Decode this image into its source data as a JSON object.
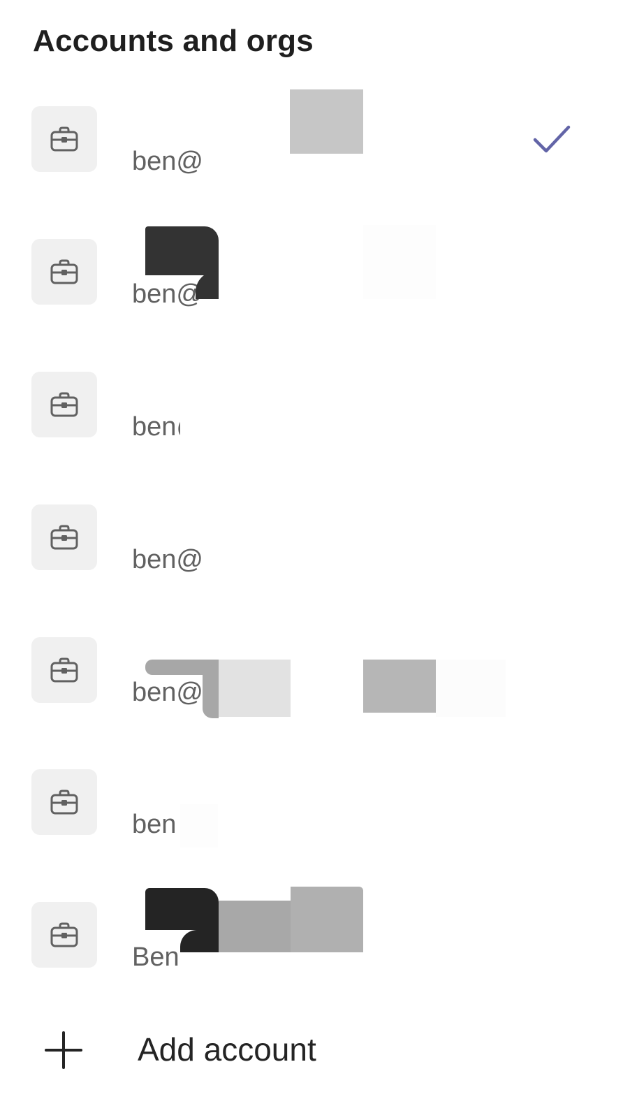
{
  "header": {
    "title": "Accounts and orgs"
  },
  "accounts": [
    {
      "email": "ben@",
      "selected": true
    },
    {
      "email": "ben@",
      "selected": false
    },
    {
      "email": "ben@",
      "selected": false
    },
    {
      "email": "ben@",
      "selected": false
    },
    {
      "email": "ben@",
      "selected": false
    },
    {
      "email": "ben",
      "selected": false
    },
    {
      "email": "Ben",
      "selected": false
    }
  ],
  "add_account": {
    "label": "Add account"
  },
  "icons": {
    "org": "briefcase-icon",
    "selected": "checkmark-icon",
    "add": "plus-icon"
  },
  "colors": {
    "accent": "#6264a7",
    "tile_background": "#f0f0f0",
    "secondary_text": "#616161",
    "primary_text": "#242424"
  }
}
